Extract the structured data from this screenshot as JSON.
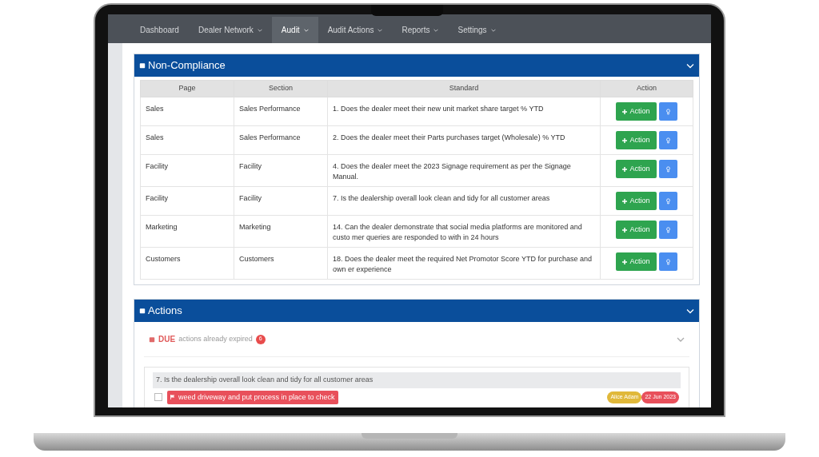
{
  "nav": [
    {
      "label": "Dashboard",
      "selected": false,
      "menu": false
    },
    {
      "label": "Dealer Network",
      "selected": false,
      "menu": true
    },
    {
      "label": "Audit",
      "selected": true,
      "menu": true
    },
    {
      "label": "Audit Actions",
      "selected": false,
      "menu": true
    },
    {
      "label": "Reports",
      "selected": false,
      "menu": true
    },
    {
      "label": "Settings",
      "selected": false,
      "menu": true
    }
  ],
  "non_compliance": {
    "title": "Non-Compliance",
    "expanded": true,
    "columns": [
      "Page",
      "Section",
      "Standard",
      "Action"
    ],
    "rows": [
      {
        "page": "Sales",
        "section": "Sales Performance",
        "standard": "1. Does the dealer meet their new unit market share target % YTD",
        "action_label": "Action"
      },
      {
        "page": "Sales",
        "section": "Sales Performance",
        "standard": "2. Does the dealer meet their Parts purchases target (Wholesale) % YTD",
        "action_label": "Action"
      },
      {
        "page": "Facility",
        "section": "Facility",
        "standard": "4. Does the dealer meet the 2023 Signage requirement as per the Signage Manual.",
        "action_label": "Action"
      },
      {
        "page": "Facility",
        "section": "Facility",
        "standard": "7. Is the dealership overall look clean and tidy for all customer areas",
        "action_label": "Action"
      },
      {
        "page": "Marketing",
        "section": "Marketing",
        "standard": "14. Can the dealer demonstrate that social media platforms are monitored and custo mer queries are responded to with in 24 hours",
        "action_label": "Action"
      },
      {
        "page": "Customers",
        "section": "Customers",
        "standard": "18. Does the dealer meet the required Net Promotor Score YTD for purchase and own er experience",
        "action_label": "Action"
      }
    ]
  },
  "actions": {
    "title": "Actions",
    "expanded": true,
    "due": {
      "label": "DUE",
      "text": "actions already expired",
      "count": "6",
      "expanded": false
    },
    "groups": [
      {
        "title": "7. Is the dealership overall look clean and tidy for all customer areas",
        "items": [
          {
            "text": "weed driveway and put process in place to check",
            "checked": false,
            "assignee": "Alice Adam",
            "date": "22 Jun 2023"
          }
        ]
      }
    ]
  }
}
